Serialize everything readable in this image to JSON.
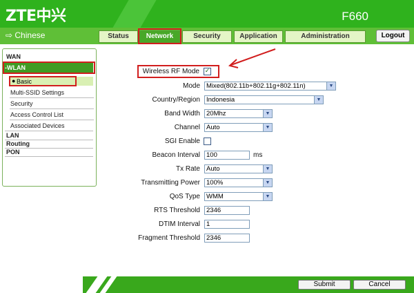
{
  "header": {
    "logo": "ZTE中兴",
    "model": "F660"
  },
  "language_label": "⇨ Chinese",
  "tabs": [
    {
      "label": "Status",
      "active": false
    },
    {
      "label": "Network",
      "active": true
    },
    {
      "label": "Security",
      "active": false
    },
    {
      "label": "Application",
      "active": false
    },
    {
      "label": "Administration",
      "active": false
    }
  ],
  "logout_label": "Logout",
  "sidebar": {
    "wan": "WAN",
    "wlan": "-WLAN",
    "wlan_items": [
      "Basic",
      "Multi-SSID Settings",
      "Security",
      "Access Control List",
      "Associated Devices"
    ],
    "lan": "LAN",
    "routing": "Routing",
    "pon": "PON"
  },
  "form": {
    "wireless_rf_mode": {
      "label": "Wireless RF Mode",
      "checked": true
    },
    "mode": {
      "label": "Mode",
      "value": "Mixed(802.11b+802.11g+802.11n)"
    },
    "country": {
      "label": "Country/Region",
      "value": "Indonesia"
    },
    "band_width": {
      "label": "Band Width",
      "value": "20Mhz"
    },
    "channel": {
      "label": "Channel",
      "value": "Auto"
    },
    "sgi_enable": {
      "label": "SGI Enable",
      "checked": false
    },
    "beacon_interval": {
      "label": "Beacon Interval",
      "value": "100",
      "unit": "ms"
    },
    "tx_rate": {
      "label": "Tx Rate",
      "value": "Auto"
    },
    "transmitting_power": {
      "label": "Transmitting Power",
      "value": "100%"
    },
    "qos_type": {
      "label": "QoS Type",
      "value": "WMM"
    },
    "rts_threshold": {
      "label": "RTS Threshold",
      "value": "2346"
    },
    "dtim_interval": {
      "label": "DTIM Interval",
      "value": "1"
    },
    "fragment_threshold": {
      "label": "Fragment Threshold",
      "value": "2346"
    }
  },
  "buttons": {
    "submit": "Submit",
    "cancel": "Cancel"
  },
  "colors": {
    "brand_green": "#2fb21d",
    "highlight_red": "#d11d1d"
  }
}
